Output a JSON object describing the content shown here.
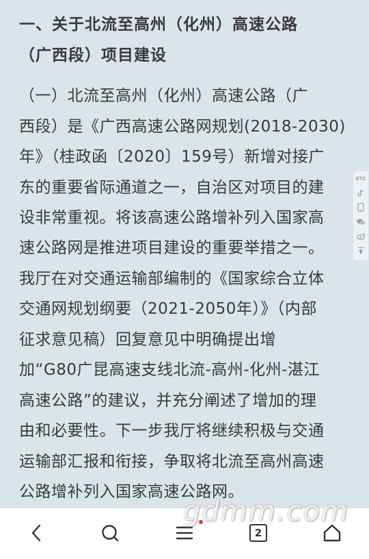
{
  "article": {
    "heading_lines": [
      "一、关于北流至高州（化州）高速公路",
      "（广西段）项目建设"
    ],
    "paragraph_lines": [
      "（一）北流至高州（化州）高速公路（广",
      "西段）是《广西高速公路网规划(2018-2030)",
      "年》（桂政函〔2020〕159号）新增对接广",
      "东的重要省际通道之一，自治区对项目的建",
      "设非常重视。将该高速公路增补列入国家高",
      "速公路网是推进项目建设的重要举措之一。",
      "我厅在对交通运输部编制的《国家综合立体",
      "交通网规划纲要（2021-2050年）》（内部",
      "征求意见稿）回复意见中明确提出增",
      "加“G80广昆高速支线北流-高州-化州-湛江",
      "高速公路”的建议，并充分阐述了增加的理",
      "由和必要性。下一步我厅将继续积极与交通",
      "运输部汇报和衔接，争取将北流至高州高速",
      "公路增补列入国家高速公路网。"
    ]
  },
  "side_rail": {
    "items": [
      {
        "label": "ETC",
        "icon": "etc-icon"
      },
      {
        "label": "",
        "icon": "tiktok-icon"
      },
      {
        "label": "",
        "icon": "phone-icon"
      },
      {
        "label": "",
        "icon": "wechat-icon"
      },
      {
        "label": "",
        "icon": "weibo-icon"
      },
      {
        "label": "",
        "icon": "back-to-top-icon"
      }
    ]
  },
  "bottom_nav": {
    "back_icon": "back-arrow-icon",
    "search_icon": "search-icon",
    "menu_icon": "menu-icon",
    "tabs_count": "2",
    "home_icon": "home-icon"
  },
  "watermark": {
    "text": "gdmm.com"
  },
  "colors": {
    "background": "#d9e5e8",
    "text": "#3a3a3a",
    "nav_icon": "#333333",
    "red_dot": "#e53935"
  }
}
